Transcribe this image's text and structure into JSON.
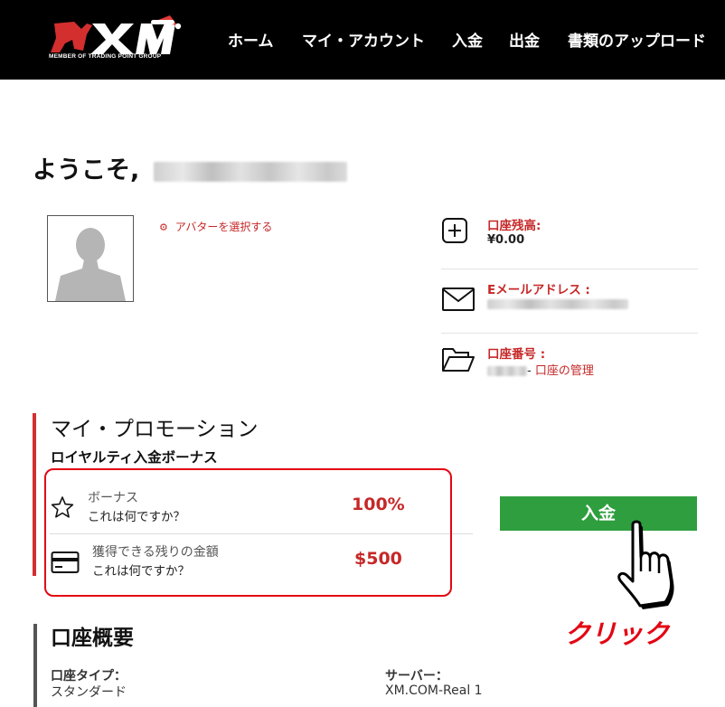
{
  "header": {
    "logo_text": "XM",
    "logo_tagline": "MEMBER OF TRADING POINT GROUP",
    "nav": [
      {
        "label": "ホーム"
      },
      {
        "label": "マイ・アカウント"
      },
      {
        "label": "入金"
      },
      {
        "label": "出金"
      },
      {
        "label": "書類のアップロード"
      }
    ]
  },
  "welcome": {
    "greeting": "ようこそ,"
  },
  "profile": {
    "avatar_link": "アバターを選択する",
    "avatar_link_icon": "gear-icon"
  },
  "account_info": {
    "balance": {
      "label": "口座残高:",
      "value": "¥0.00",
      "icon": "plus-square-icon"
    },
    "email": {
      "label": "Eメールアドレス :",
      "icon": "envelope-icon"
    },
    "account_number": {
      "label": "口座番号 :",
      "manage_link": "口座の管理",
      "separator": "- ",
      "icon": "folder-open-icon"
    }
  },
  "promotions": {
    "title": "マイ・プロモーション",
    "subtitle": "ロイヤルティ入金ボーナス",
    "rows": [
      {
        "title": "ボーナス",
        "help": "これは何ですか？",
        "value": "100%",
        "icon": "star-icon"
      },
      {
        "title": "獲得できる残りの金額",
        "help": "これは何ですか？",
        "value": "$500",
        "icon": "credit-card-icon"
      }
    ]
  },
  "deposit_button": {
    "label": "入金"
  },
  "annotation": {
    "label": "クリック",
    "icon": "pointing-hand-icon"
  },
  "account_summary": {
    "title": "口座概要",
    "type_label": "口座タイプ：",
    "type_value": "スタンダード",
    "server_label": "サーバー：",
    "server_value": "XM.COM-Real 1"
  },
  "colors": {
    "header_bg": "#000000",
    "accent_red": "#c62828",
    "highlight_border": "#e30613",
    "deposit_green": "#2e9e3e"
  }
}
